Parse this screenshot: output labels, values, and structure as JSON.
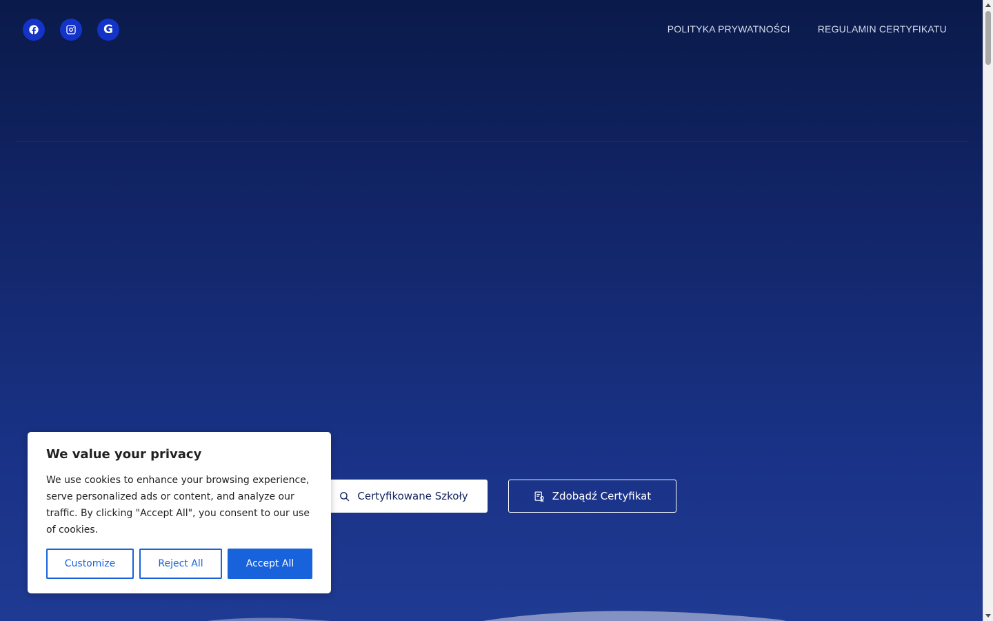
{
  "header": {
    "social": [
      {
        "icon": "facebook-icon"
      },
      {
        "icon": "instagram-icon"
      },
      {
        "icon": "google-icon",
        "glyph": "G"
      }
    ],
    "nav": [
      {
        "label": "POLITYKA PRYWATNOŚCI"
      },
      {
        "label": "REGULAMIN CERTYFIKATU"
      }
    ]
  },
  "hero": {
    "primary_button": {
      "label": "Certyfikowane Szkoły",
      "icon": "search-icon"
    },
    "secondary_button": {
      "label": "Zdobądź Certyfikat",
      "icon": "certificate-icon"
    }
  },
  "cookie": {
    "title": "We value your privacy",
    "text": "We use cookies to enhance your browsing experience, serve personalized ads or content, and analyze our traffic. By clicking \"Accept All\", you consent to our use of cookies.",
    "customize": "Customize",
    "reject": "Reject All",
    "accept": "Accept All"
  },
  "colors": {
    "background_top": "#0a1a4a",
    "background_bottom": "#1f3a92",
    "social_circle": "#1433c8",
    "cookie_accent": "#1863dc"
  }
}
